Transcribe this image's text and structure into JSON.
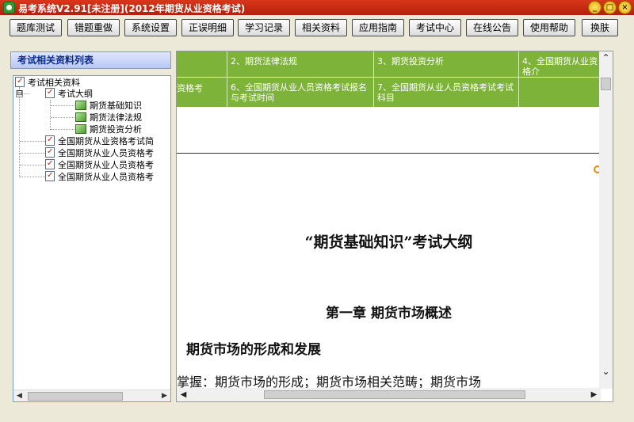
{
  "window": {
    "title": "易考系统V2.91[未注册](2012年期货从业资格考试)",
    "controls": [
      "_",
      "□",
      "×"
    ]
  },
  "toolbar": {
    "buttons": [
      "题库测试",
      "错题重做",
      "系统设置",
      "正误明细",
      "学习记录",
      "相关资料",
      "应用指南",
      "考试中心",
      "在线公告",
      "使用帮助",
      "换肤"
    ]
  },
  "sidebar": {
    "header": "考试相关资料列表",
    "tree": {
      "root": "考试相关资料",
      "outline": "考试大纲",
      "outline_children": [
        "期货基础知识",
        "期货法律法规",
        "期货投资分析"
      ],
      "others": [
        "全国期货从业资格考试简",
        "全国期货从业人员资格考",
        "全国期货从业人员资格考",
        "全国期货从业人员资格考"
      ],
      "expander_symbol": "⊟"
    }
  },
  "content": {
    "table": {
      "row1": [
        "2、期货法律法规",
        "3、期货投资分析",
        "4、全国期货从业资格介"
      ],
      "row2": [
        "资格考",
        "6、全国期货从业人员资格考试报名与考试时间",
        "7、全国期货从业人员资格考试考试科目"
      ]
    },
    "doc_title": "“期货基础知识”考试大纲",
    "chapter": "第一章  期货市场概述",
    "section": "期货市场的形成和发展",
    "body_text": "掌握：期货市场的形成；期货市场相关范畴；期货市场"
  },
  "colors": {
    "titlebar": "#c62a12",
    "table_green": "#7eb33a",
    "header_blue": "#0b2a8a"
  }
}
